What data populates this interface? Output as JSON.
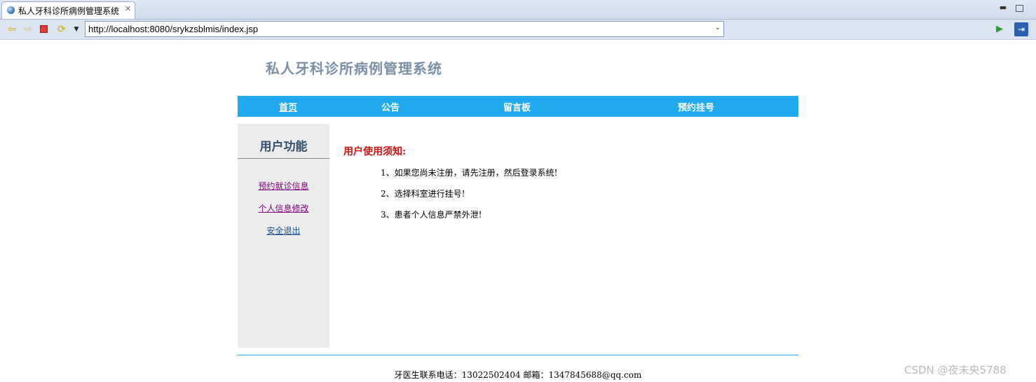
{
  "editor_tab": {
    "title": "私人牙科诊所病例管理系统",
    "close_glyph": "✕"
  },
  "browser": {
    "url": "http://localhost:8080/srykzsblmis/index.jsp"
  },
  "page": {
    "site_title": "私人牙科诊所病例管理系统",
    "nav": {
      "home": "首页",
      "notice": "公告",
      "message_board": "留言板",
      "appointment": "预约挂号"
    },
    "sidebar": {
      "heading": "用户功能",
      "links": [
        "预约就诊信息",
        "个人信息修改",
        "安全退出"
      ]
    },
    "notice": {
      "title": "用户使用须知:",
      "items": [
        "1、如果您尚未注册，请先注册，然后登录系统!",
        "2、选择科室进行挂号!",
        "3、患者个人信息严禁外泄!"
      ]
    },
    "footer": "牙医生联系电话：13022502404 邮箱：1347845688@qq.com"
  },
  "watermark": "CSDN @夜未央5788",
  "colors": {
    "nav_bg": "#22aaf0",
    "notice_title": "#cc1111",
    "visited_link": "#800080",
    "link": "#1a4f8b"
  }
}
